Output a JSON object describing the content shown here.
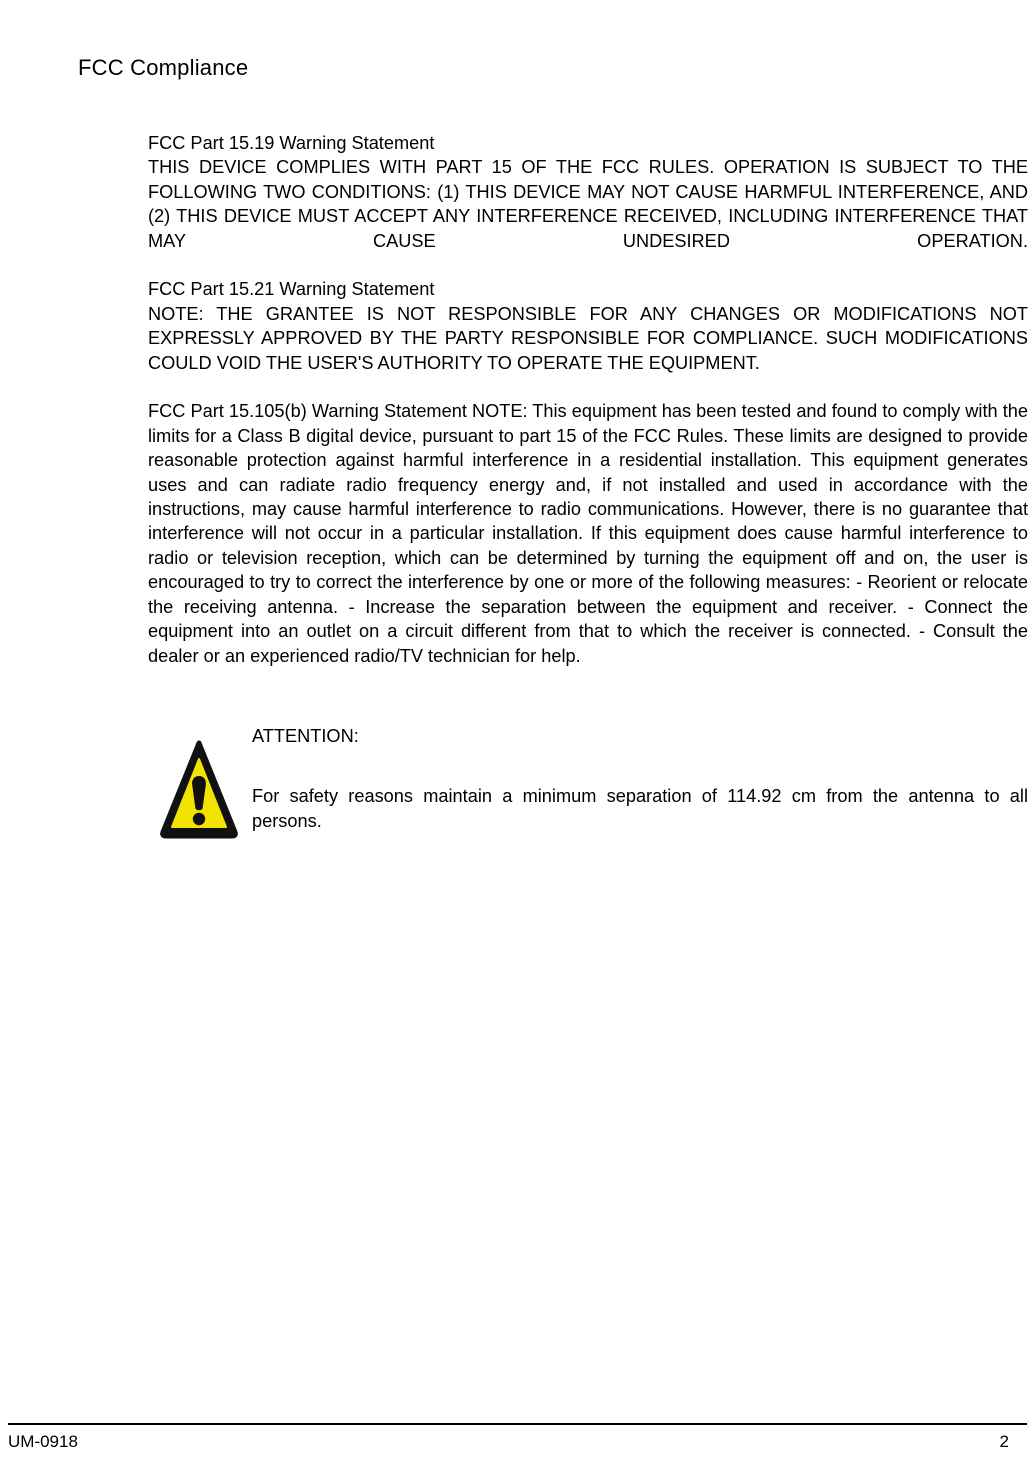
{
  "document": {
    "header_title": "FCC Compliance",
    "warning_icon_name": "warning-triangle-icon",
    "colors": {
      "warning_fill": "#F2E400",
      "warning_border": "#111111",
      "text": "#000000",
      "page_background": "#FFFFFF"
    }
  },
  "sections": {
    "part_15_19": {
      "heading": "FCC Part 15.19 Warning Statement",
      "body": "THIS DEVICE COMPLIES WITH PART 15 OF THE FCC RULES. OPERATION IS SUBJECT TO THE FOLLOWING TWO CONDITIONS: (1) THIS DEVICE MAY NOT CAUSE HARMFUL INTERFERENCE, AND (2) THIS DEVICE MUST ACCEPT ANY INTERFERENCE RECEIVED, INCLUDING INTERFERENCE THAT MAY CAUSE UNDESIRED OPERATION."
    },
    "part_15_21": {
      "heading": "FCC Part 15.21 Warning Statement",
      "body": "NOTE: THE GRANTEE IS NOT RESPONSIBLE FOR ANY CHANGES OR MODIFICATIONS NOT EXPRESSLY APPROVED BY THE PARTY RESPONSIBLE FOR COMPLIANCE. SUCH MODIFICATIONS COULD VOID THE USER'S AUTHORITY TO OPERATE THE EQUIPMENT."
    },
    "part_15_105b": {
      "body": "FCC Part 15.105(b) Warning Statement NOTE: This equipment has been tested and found to comply with the limits for a Class B digital device, pursuant to part 15 of the FCC Rules. These limits are designed to provide reasonable protection against harmful interference in a residential installation. This equipment generates uses and can radiate radio frequency energy and, if not installed and used in accordance with the instructions, may cause harmful interference to radio communications. However, there is no guarantee that interference will not occur in a particular installation. If this equipment does cause harmful interference to radio or television reception, which can be determined by turning the equipment off and on, the user is encouraged to try to correct the interference by one or more of the following measures: - Reorient or relocate the receiving antenna. - Increase the separation between the equipment and receiver. - Connect the equipment into an outlet on a circuit different from that to which the receiver is connected. - Consult the dealer or an experienced radio/TV technician for help."
    }
  },
  "attention": {
    "title": "ATTENTION:",
    "body": "For safety reasons maintain a minimum separation of 114.92 cm from the antenna to all persons.",
    "separation_distance": "114.92 cm"
  },
  "footer": {
    "document_code": "UM-0918",
    "page_number": "2"
  }
}
